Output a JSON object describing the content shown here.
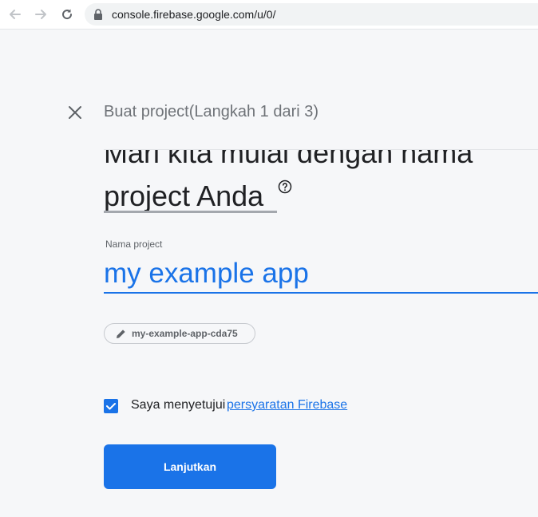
{
  "browser": {
    "url": "console.firebase.google.com/u/0/",
    "back_icon": "arrow-left-icon",
    "forward_icon": "arrow-right-icon",
    "reload_icon": "reload-icon",
    "lock_icon": "lock-icon"
  },
  "header": {
    "step_title": "Buat project(Langkah 1 dari 3)",
    "close_icon": "close-icon"
  },
  "main": {
    "heading_line1": "Mari kita mulai dengan nama",
    "heading_line2": "project Anda",
    "help_icon": "help-circle-icon",
    "project_name_label": "Nama project",
    "project_name_value": "my example app",
    "project_id": "my-example-app-cda75",
    "edit_icon": "pencil-icon",
    "terms_text": "Saya menyetujui",
    "terms_link": "persyaratan Firebase",
    "terms_checked": true,
    "continue_label": "Lanjutkan"
  },
  "colors": {
    "accent": "#1a73e8",
    "background": "#f6f7f9",
    "text": "#202124",
    "muted_text": "#6f7378"
  }
}
